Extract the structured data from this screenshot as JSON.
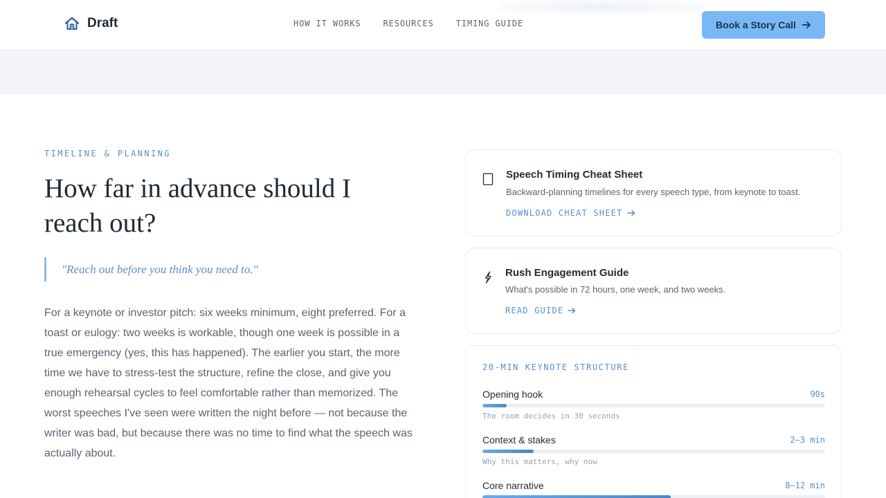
{
  "header": {
    "brand": "Draft",
    "nav": [
      "HOW IT WORKS",
      "RESOURCES",
      "TIMING GUIDE"
    ],
    "cta": "Book a Story Call"
  },
  "faq": {
    "eyebrow": "TIMELINE & PLANNING",
    "question": "How far in advance should I reach out?",
    "quote": "\"Reach out before you think you need to.\"",
    "answer": "For a keynote or investor pitch: six weeks minimum, eight preferred. For a toast or eulogy: two weeks is workable, though one week is possible in a true emergency (yes, this has happened). The earlier you start, the more time we have to stress-test the structure, refine the close, and give you enough rehearsal cycles to feel comfortable rather than memorized. The worst speeches I've seen were written the night before — not because the writer was bad, but because there was no time to find what the speech was actually about."
  },
  "resources": [
    {
      "icon": "document-icon",
      "title": "Speech Timing Cheat Sheet",
      "description": "Backward-planning timelines for every speech type, from keynote to toast.",
      "link": "DOWNLOAD CHEAT SHEET"
    },
    {
      "icon": "lightning-icon",
      "title": "Rush Engagement Guide",
      "description": "What's possible in 72 hours, one week, and two weeks.",
      "link": "READ GUIDE"
    }
  ],
  "structure": {
    "title": "20-MIN KEYNOTE STRUCTURE",
    "rows": [
      {
        "label": "Opening hook",
        "time": "90s",
        "note": "The room decides in 30 seconds",
        "progress": 0.07
      },
      {
        "label": "Context & stakes",
        "time": "2–3 min",
        "note": "Why this matters, why now",
        "progress": 0.15
      },
      {
        "label": "Core narrative",
        "time": "8–12 min",
        "note": "",
        "progress": 0.55
      }
    ]
  },
  "colors": {
    "accent": "#5b8fc7",
    "cta_background": "#7ab8f5",
    "heading": "#1f2a36",
    "body": "#5a6470"
  }
}
